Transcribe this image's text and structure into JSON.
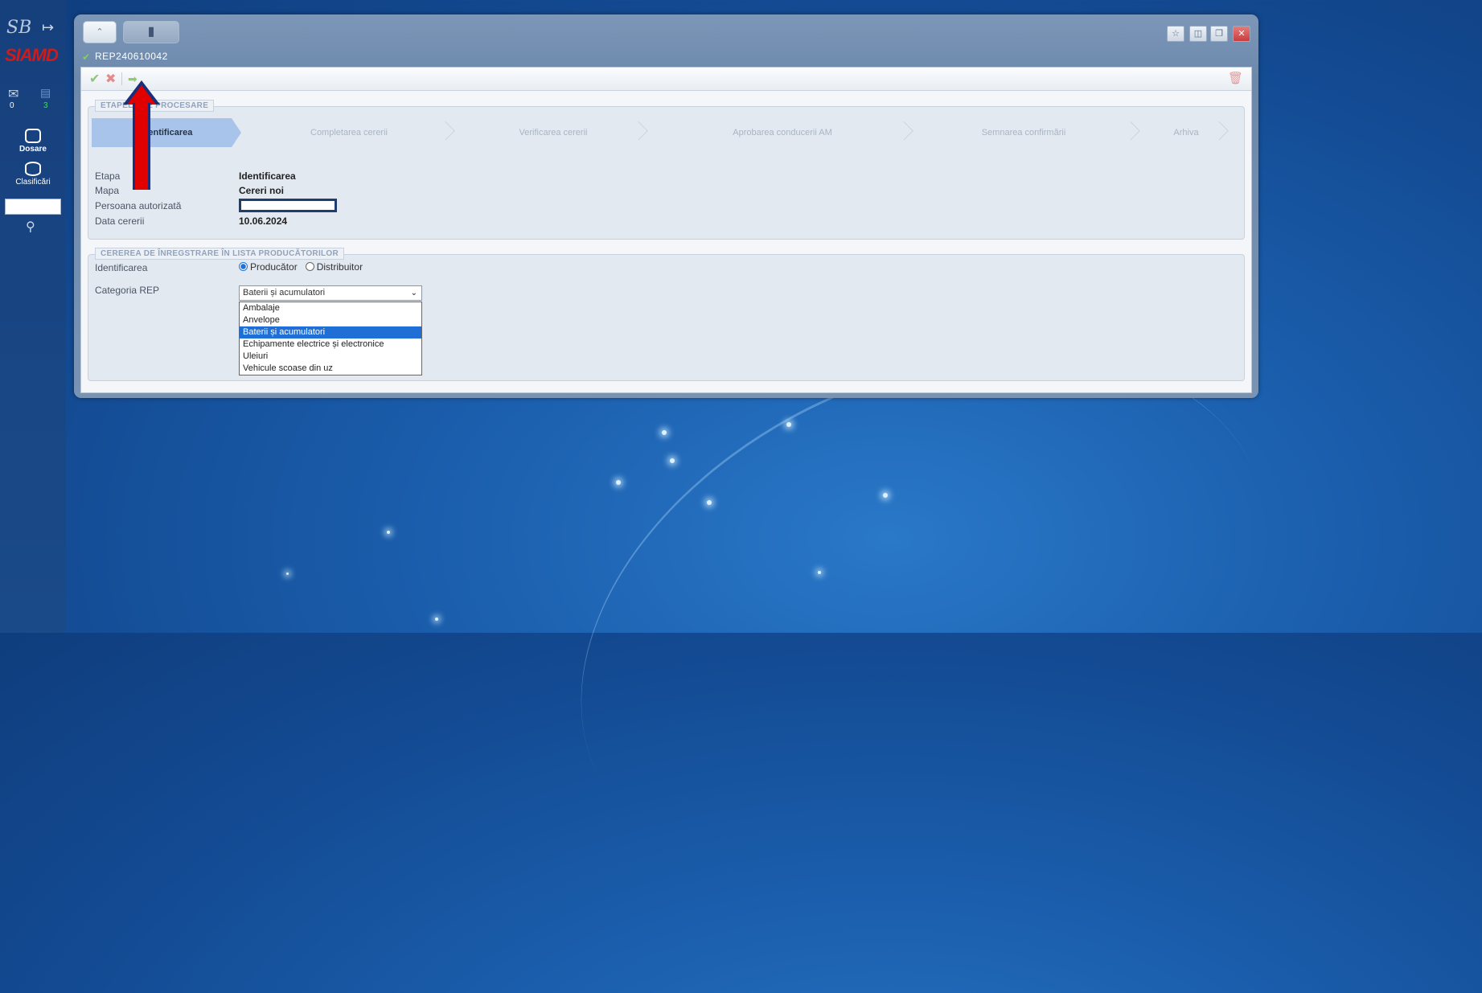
{
  "sidebar": {
    "logo": "SB",
    "brand": "SIAMD",
    "mail_count": "0",
    "inbox_count": "3",
    "items": [
      {
        "label": "Dosare"
      },
      {
        "label": "Clasificări"
      }
    ]
  },
  "window": {
    "title": "REP240610042"
  },
  "process_panel": {
    "legend": "ETAPELE DE PROCESARE",
    "steps": [
      {
        "label": "Identificarea"
      },
      {
        "label": "Completarea cererii"
      },
      {
        "label": "Verificarea cererii"
      },
      {
        "label": "Aprobarea conducerii AM"
      },
      {
        "label": "Semnarea confirmării"
      },
      {
        "label": "Arhiva"
      }
    ],
    "active_step": 0,
    "fields": [
      {
        "label": "Etapa",
        "value": "Identificarea"
      },
      {
        "label": "Mapa",
        "value": "Cereri noi"
      },
      {
        "label": "Persoana autorizată",
        "value": ""
      },
      {
        "label": "Data cererii",
        "value": "10.06.2024"
      }
    ]
  },
  "request_panel": {
    "legend": "CEREREA DE ÎNREGSTRARE ÎN LISTA PRODUCĂTORILOR",
    "identification_label": "Identificarea",
    "radio_options": [
      {
        "label": "Producător",
        "checked": true
      },
      {
        "label": "Distribuitor",
        "checked": false
      }
    ],
    "category_label": "Categoria REP",
    "category_selected": "Baterii și acumulatori",
    "category_options": [
      "Ambalaje",
      "Anvelope",
      "Baterii și acumulatori",
      "Echipamente electrice și electronice",
      "Uleiuri",
      "Vehicule scoase din uz"
    ],
    "selected_index": 2
  },
  "colors": {
    "accent": "#1f6fd6",
    "active_step": "#a9c4ea",
    "annotation_arrow": "#e00000"
  }
}
